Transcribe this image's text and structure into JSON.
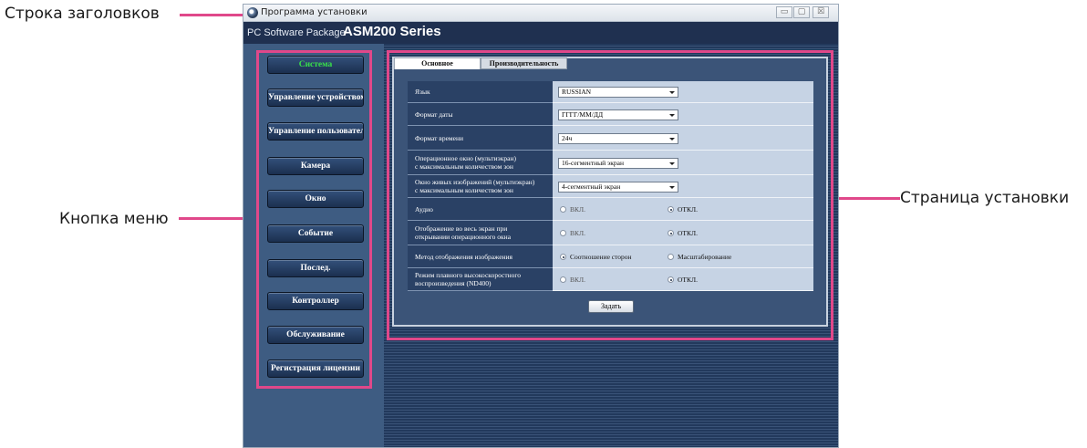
{
  "callouts": {
    "title_bar": "Строка заголовков",
    "menu_button": "Кнопка меню",
    "settings_page": "Страница установки"
  },
  "window": {
    "title": "Программа установки",
    "controls": {
      "minimize": "▭",
      "maximize": "▢",
      "close": "☒"
    }
  },
  "header": {
    "pc_label": "PC Software Package",
    "series": "ASM200 Series"
  },
  "menu": {
    "items": [
      {
        "label": "Система",
        "active": true
      },
      {
        "label": "Управление устройством"
      },
      {
        "label": "Управление пользователем"
      },
      {
        "label": "Камера"
      },
      {
        "label": "Окно"
      },
      {
        "label": "Событие"
      },
      {
        "label": "Послед."
      },
      {
        "label": "Контроллер"
      },
      {
        "label": "Обслуживание"
      },
      {
        "label": "Регистрация лицензии"
      }
    ]
  },
  "tabs": [
    {
      "label": "Основное",
      "active": true
    },
    {
      "label": "Производительность",
      "active": false
    }
  ],
  "form": {
    "language": {
      "label": "Язык",
      "value": "RUSSIAN"
    },
    "date_format": {
      "label": "Формат даты",
      "value": "ГГГГ/ММ/ДД"
    },
    "time_format": {
      "label": "Формат времени",
      "value": "24ч"
    },
    "operation_window": {
      "label_line1": "Операционное окно (мультиэкран)",
      "label_line2": "с максимальным количеством зон",
      "value": "16-сегментный экран"
    },
    "live_window": {
      "label_line1": "Окно живых изображений (мультиэкран)",
      "label_line2": "с максимальным количеством зон",
      "value": "4-сегментный экран"
    },
    "audio": {
      "label": "Аудио",
      "on": "ВКЛ.",
      "off": "ОТКЛ.",
      "selected": "off"
    },
    "fullscreen": {
      "label_line1": "Отображение во весь экран при",
      "label_line2": "открывании операционного окна",
      "on": "ВКЛ.",
      "off": "ОТКЛ.",
      "selected": "off"
    },
    "display_method": {
      "label": "Метод отображения изображения",
      "option1": "Соотношение сторон",
      "option2": "Масштабирование",
      "selected": "option1"
    },
    "smooth_playback": {
      "label_line1": "Режим плавного высокоскоростного",
      "label_line2": "воспроизведения (ND400)",
      "on": "ВКЛ.",
      "off": "ОТКЛ.",
      "selected": "off"
    },
    "set_button": "Задать"
  },
  "colors": {
    "accent": "#e0488a",
    "active_menu": "#38e04a",
    "background": "#23385a"
  }
}
